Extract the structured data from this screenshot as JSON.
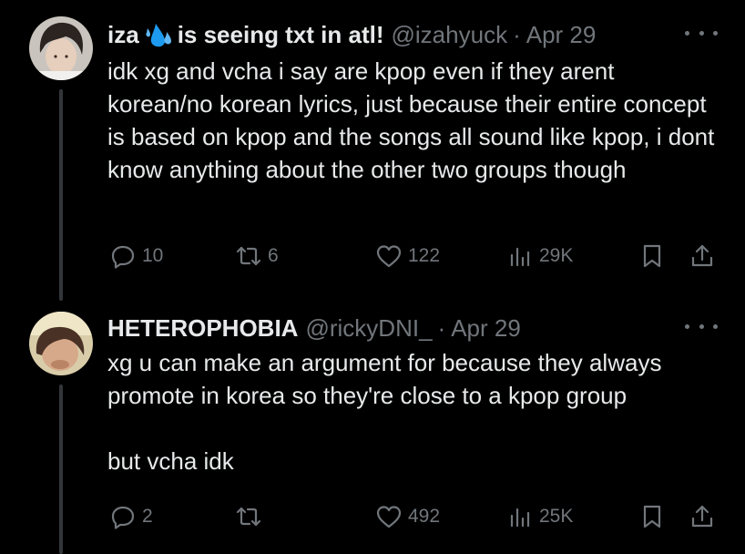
{
  "tweets": [
    {
      "author_name": "iza",
      "name_suffix": "is seeing txt in atl!",
      "handle": "@izahyuck",
      "date": "Apr 29",
      "text": "idk xg and vcha i say are kpop even if they arent korean/no korean lyrics, just because their entire concept is based on kpop and the songs all sound like kpop, i dont know anything about the other two groups though",
      "replies": "10",
      "retweets": "6",
      "likes": "122",
      "views": "29K"
    },
    {
      "author_name": "HETEROPHOBIA",
      "handle": "@rickyDNI_",
      "date": "Apr 29",
      "text_lines": [
        "xg u can make an argument for because they always promote in korea so they're close to a kpop group",
        "but vcha idk"
      ],
      "replies": "2",
      "retweets": "",
      "likes": "492",
      "views": "25K"
    }
  ],
  "separator": "·",
  "colors": {
    "background": "#000000",
    "text": "#e7e9ea",
    "secondary": "#71767b",
    "thread_line": "#333639",
    "emoji_blue": "#1d9bf0"
  },
  "icons": [
    "reply-icon",
    "retweet-icon",
    "like-icon",
    "views-icon",
    "bookmark-icon",
    "share-icon",
    "more-icon",
    "sweat-droplets-emoji"
  ]
}
